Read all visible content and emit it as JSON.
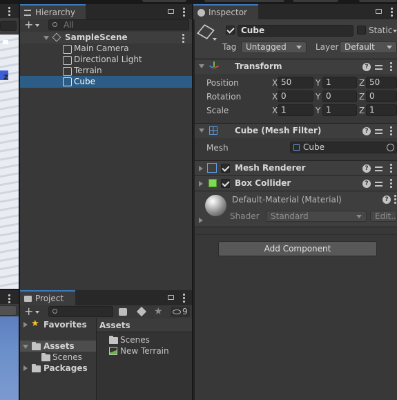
{
  "hierarchy": {
    "tab_label": "Hierarchy",
    "search_placeholder": "All",
    "scene_name": "SampleScene",
    "objects": [
      "Main Camera",
      "Directional Light",
      "Terrain",
      "Cube"
    ],
    "selected": "Cube"
  },
  "inspector": {
    "tab_label": "Inspector",
    "object_name": "Cube",
    "static_label": "Static",
    "tag_label": "Tag",
    "tag_value": "Untagged",
    "layer_label": "Layer",
    "layer_value": "Default",
    "transform": {
      "title": "Transform",
      "position_label": "Position",
      "rotation_label": "Rotation",
      "scale_label": "Scale",
      "axis_x": "X",
      "axis_y": "Y",
      "axis_z": "Z",
      "position": [
        "50",
        "1",
        "50"
      ],
      "rotation": [
        "0",
        "0",
        "0"
      ],
      "scale": [
        "1",
        "1",
        "1"
      ]
    },
    "mesh_filter": {
      "title": "Cube (Mesh Filter)",
      "mesh_label": "Mesh",
      "mesh_value": "Cube"
    },
    "mesh_renderer": {
      "title": "Mesh Renderer"
    },
    "box_collider": {
      "title": "Box Collider"
    },
    "material": {
      "title": "Default-Material (Material)",
      "shader_label": "Shader",
      "shader_value": "Standard",
      "edit_label": "Edit..."
    },
    "add_component_label": "Add Component"
  },
  "project": {
    "tab_label": "Project",
    "hidden_count": "9",
    "tree": {
      "favorites": "Favorites",
      "assets": "Assets",
      "scenes": "Scenes",
      "packages": "Packages"
    },
    "breadcrumb": "Assets",
    "items": [
      "Scenes",
      "New Terrain"
    ]
  },
  "scene_view": {
    "axis_label": "z"
  },
  "colors": {
    "selection": "#2c5d87",
    "tab_accent": "#3a79bb",
    "panel": "#383838",
    "header": "#3e3e3e"
  }
}
